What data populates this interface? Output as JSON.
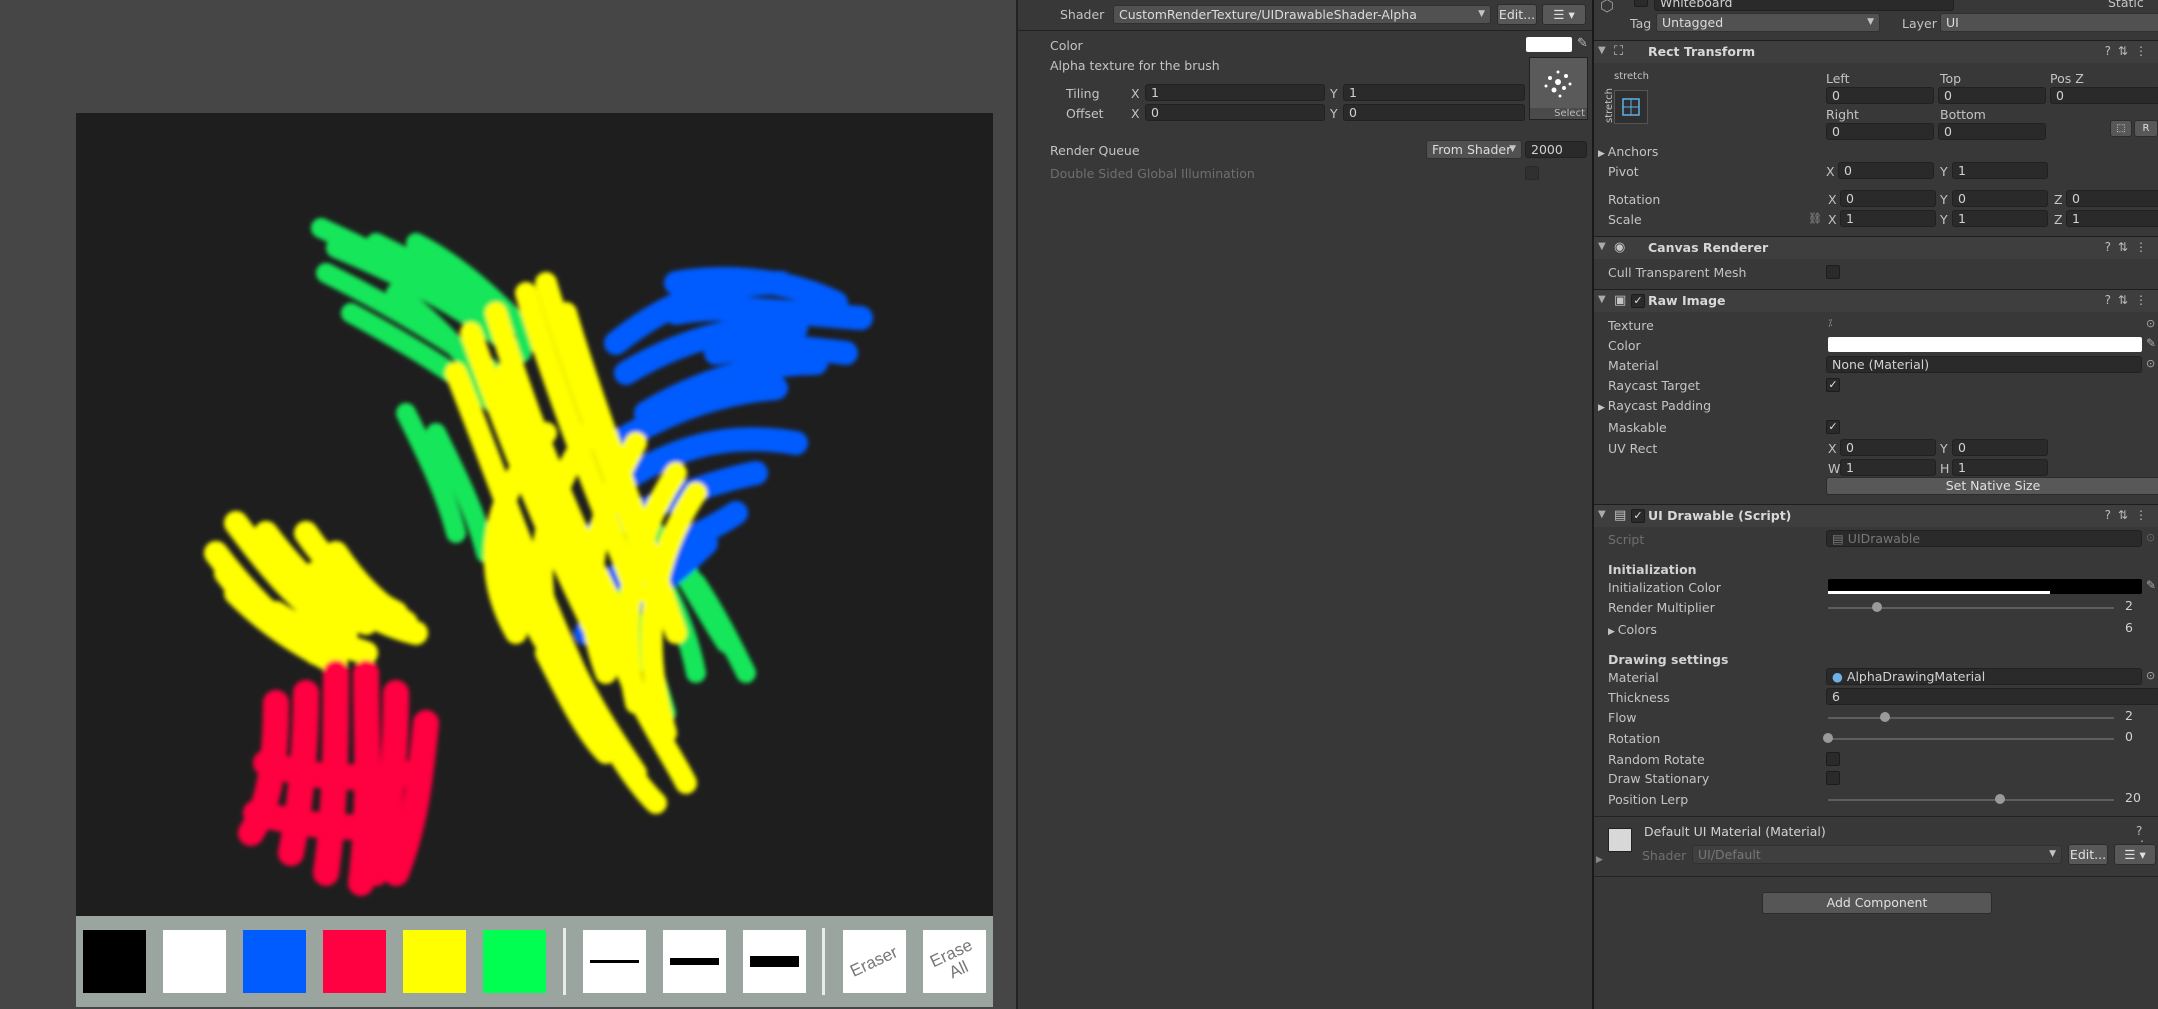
{
  "toolbar": {
    "swatches": [
      {
        "name": "black",
        "color": "#000000"
      },
      {
        "name": "white",
        "color": "#ffffff"
      },
      {
        "name": "blue",
        "color": "#005cff"
      },
      {
        "name": "red",
        "color": "#ff0041"
      },
      {
        "name": "yellow",
        "color": "#ffff00"
      },
      {
        "name": "green",
        "color": "#00ff50"
      }
    ],
    "eraser_label": "Eraser",
    "erase_all_label": "Erase All"
  },
  "material": {
    "shader_label": "Shader",
    "shader_value": "CustomRenderTexture/UIDrawableShader-Alpha",
    "edit_label": "Edit...",
    "color_label": "Color",
    "alpha_label": "Alpha texture for the brush",
    "tiling_label": "Tiling",
    "offset_label": "Offset",
    "tiling_x": "1",
    "tiling_y": "1",
    "offset_x": "0",
    "offset_y": "0",
    "select_label": "Select",
    "render_queue_label": "Render Queue",
    "render_queue_mode": "From Shader",
    "render_queue_value": "2000",
    "double_sided_label": "Double Sided Global Illumination"
  },
  "inspector": {
    "object_name": "Whiteboard",
    "static_label": "Static",
    "tag_label": "Tag",
    "tag_value": "Untagged",
    "layer_label": "Layer",
    "layer_value": "UI",
    "rect_transform": {
      "title": "Rect Transform",
      "stretch": "stretch",
      "left_label": "Left",
      "left": "0",
      "top_label": "Top",
      "top": "0",
      "posz_label": "Pos Z",
      "posz": "0",
      "right_label": "Right",
      "right": "0",
      "bottom_label": "Bottom",
      "bottom": "0",
      "anchors_label": "Anchors",
      "pivot_label": "Pivot",
      "pivot_x": "0",
      "pivot_y": "1",
      "rotation_label": "Rotation",
      "rot_x": "0",
      "rot_y": "0",
      "rot_z": "0",
      "scale_label": "Scale",
      "scale_x": "1",
      "scale_y": "1",
      "scale_z": "1",
      "r_label": "R"
    },
    "canvas_renderer": {
      "title": "Canvas Renderer",
      "cull_label": "Cull Transparent Mesh"
    },
    "raw_image": {
      "title": "Raw Image",
      "texture_label": "Texture",
      "color_label": "Color",
      "material_label": "Material",
      "material_value": "None (Material)",
      "raycast_target_label": "Raycast Target",
      "raycast_padding_label": "Raycast Padding",
      "maskable_label": "Maskable",
      "uvrect_label": "UV Rect",
      "uv_x": "0",
      "uv_y": "0",
      "uv_w": "1",
      "uv_h": "1",
      "set_native_label": "Set Native Size"
    },
    "ui_drawable": {
      "title": "UI Drawable (Script)",
      "script_label": "Script",
      "script_value": "UIDrawable",
      "init_heading": "Initialization",
      "init_color_label": "Initialization Color",
      "render_mult_label": "Render Multiplier",
      "render_mult_value": "2",
      "render_mult_fraction": 0.17,
      "colors_label": "Colors",
      "colors_value": "6",
      "drawing_heading": "Drawing settings",
      "material_label": "Material",
      "material_value": "AlphaDrawingMaterial",
      "thickness_label": "Thickness",
      "thickness_value": "6",
      "flow_label": "Flow",
      "flow_value": "2",
      "flow_fraction": 0.2,
      "rotation_label": "Rotation",
      "rotation_value": "0",
      "rotation_fraction": 0.0,
      "random_rotate_label": "Random Rotate",
      "draw_stationary_label": "Draw Stationary",
      "position_lerp_label": "Position Lerp",
      "position_lerp_value": "20",
      "position_lerp_fraction": 0.6
    },
    "default_material": {
      "title": "Default UI Material (Material)",
      "shader_label": "Shader",
      "shader_value": "UI/Default",
      "edit_label": "Edit..."
    },
    "add_component_label": "Add Component"
  }
}
